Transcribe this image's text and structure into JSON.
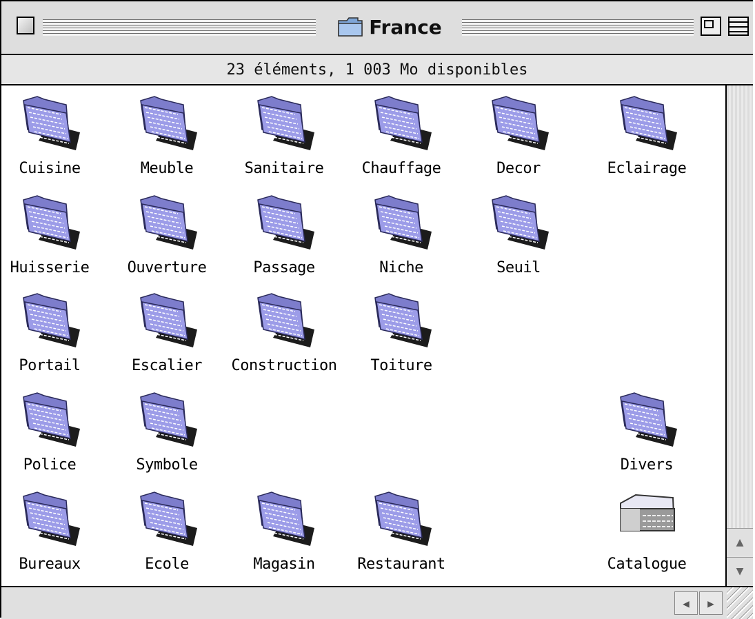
{
  "window": {
    "title": "France",
    "info": "23 éléments, 1 003  Mo disponibles"
  },
  "folders": [
    {
      "label": "Cuisine",
      "icon": "folder-icon"
    },
    {
      "label": "Meuble",
      "icon": "folder-icon"
    },
    {
      "label": "Sanitaire",
      "icon": "folder-icon"
    },
    {
      "label": "Chauffage",
      "icon": "folder-icon"
    },
    {
      "label": "Decor",
      "icon": "folder-icon"
    },
    {
      "label": "Eclairage",
      "icon": "folder-icon"
    },
    {
      "label": "Huisserie",
      "icon": "folder-icon"
    },
    {
      "label": "Ouverture",
      "icon": "folder-icon"
    },
    {
      "label": "Passage",
      "icon": "folder-icon"
    },
    {
      "label": "Niche",
      "icon": "folder-icon"
    },
    {
      "label": "Seuil",
      "icon": "folder-icon"
    },
    {
      "label": "Portail",
      "icon": "folder-icon"
    },
    {
      "label": "Escalier",
      "icon": "folder-icon"
    },
    {
      "label": "Construction",
      "icon": "folder-icon"
    },
    {
      "label": "Toiture",
      "icon": "folder-icon"
    },
    {
      "label": "Police",
      "icon": "folder-icon"
    },
    {
      "label": "Symbole",
      "icon": "folder-icon"
    },
    {
      "label": "Divers",
      "icon": "folder-icon"
    },
    {
      "label": "Bureaux",
      "icon": "folder-icon"
    },
    {
      "label": "Ecole",
      "icon": "folder-icon"
    },
    {
      "label": "Magasin",
      "icon": "folder-icon"
    },
    {
      "label": "Restaurant",
      "icon": "folder-icon"
    },
    {
      "label": "Catalogue",
      "icon": "catalog-icon"
    }
  ],
  "colors": {
    "folder_face": "#9c9ce8",
    "folder_shadow": "#1c1c1c",
    "folder_lines": "#ffffff"
  }
}
